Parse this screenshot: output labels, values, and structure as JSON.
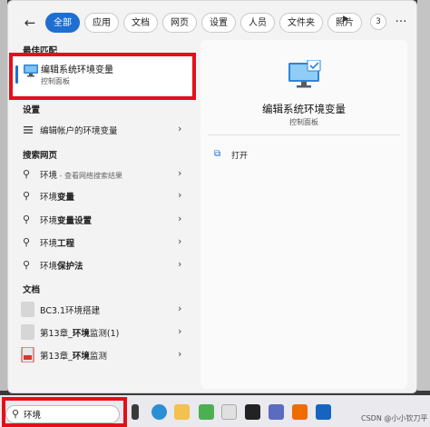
{
  "filters": {
    "back_label": "←",
    "chips": [
      "全部",
      "应用",
      "文档",
      "网页",
      "设置",
      "人员",
      "文件夹",
      "照片"
    ],
    "play_label": "▶",
    "badge": "3",
    "more_label": "…"
  },
  "best_match": {
    "heading": "最佳匹配",
    "title": "编辑系统环境变量",
    "subtitle": "控制面板"
  },
  "settings": {
    "heading": "设置",
    "items": [
      {
        "label": "编辑帐户的环境变量"
      }
    ]
  },
  "web": {
    "heading": "搜索网页",
    "items": [
      {
        "label": "环境",
        "hint": " - 查看网络搜索结果"
      },
      {
        "prefix": "环境",
        "bold": "变量"
      },
      {
        "prefix": "环境",
        "bold": "变量设置"
      },
      {
        "prefix": "环境",
        "bold": "工程"
      },
      {
        "prefix": "环境",
        "bold": "保护法"
      }
    ]
  },
  "docs": {
    "heading": "文档",
    "items": [
      {
        "label": "BC3.1环境搭建"
      },
      {
        "prefix": "第13章_",
        "bold": "环境",
        "suffix": "监测(1)"
      },
      {
        "prefix": "第13章_",
        "bold": "环境",
        "suffix": "监测"
      }
    ]
  },
  "detail": {
    "title": "编辑系统环境变量",
    "subtitle": "控制面板",
    "open_label": "打开"
  },
  "taskbar": {
    "search_value": "环境",
    "watermark": "CSDN @小小钦刀平"
  },
  "icons": {
    "back": "arrow-left-icon",
    "search": "magnifier-icon",
    "chevron": "chevron-right-icon",
    "open": "open-external-icon"
  },
  "colors": {
    "accent": "#1f6fd1",
    "highlight_box": "#e3101b"
  }
}
